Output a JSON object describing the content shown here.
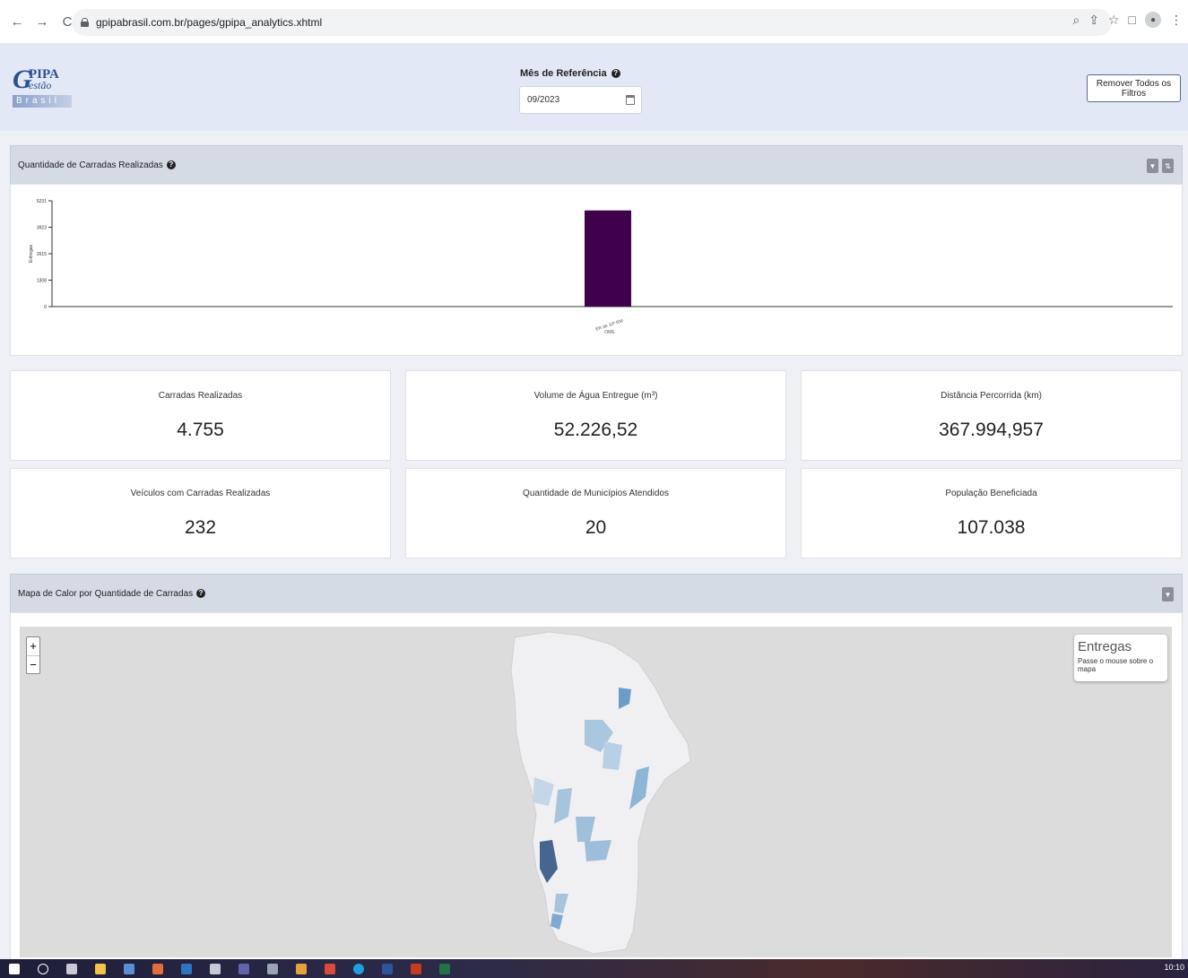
{
  "browser": {
    "url": "gpipabrasil.com.br/pages/gpipa_analytics.xhtml",
    "back_icon": "←",
    "forward_icon": "→",
    "reload_icon": "C"
  },
  "header": {
    "logo": {
      "line1": "PIPA",
      "line2": "estão",
      "line3": "Brasil",
      "g": "G"
    },
    "ref_label": "Mês de Referência",
    "ref_value": "09/2023",
    "remove_filters": "Remover Todos os Filtros"
  },
  "chart_panel": {
    "title": "Quantidade de Carradas Realizadas"
  },
  "chart_data": {
    "type": "bar",
    "categories": [
      "ER de 10ª RM"
    ],
    "values": [
      4755
    ],
    "xlabel": "OME",
    "ylabel": "Entregas",
    "yticks": [
      "0",
      "1308",
      "2615",
      "3923",
      "5231"
    ],
    "ylim": [
      0,
      5231
    ],
    "bar_color": "#40004b",
    "grid": false
  },
  "kpis": [
    {
      "label": "Carradas Realizadas",
      "value": "4.755"
    },
    {
      "label": "Volume de Água Entregue (m³)",
      "value": "52.226,52"
    },
    {
      "label": "Distância Percorrida (km)",
      "value": "367.994,957"
    },
    {
      "label": "Veículos com Carradas Realizadas",
      "value": "232"
    },
    {
      "label": "Quantidade de Municípios Atendidos",
      "value": "20"
    },
    {
      "label": "População Beneficiada",
      "value": "107.038"
    }
  ],
  "map_panel": {
    "title": "Mapa de Calor por Quantidade de Carradas",
    "zoom_in": "+",
    "zoom_out": "−",
    "legend_title": "Entregas",
    "legend_sub": "Passe o mouse sobre o mapa"
  },
  "taskbar": {
    "time": "10:10"
  },
  "colors": {
    "header_bg": "#e3e8f7",
    "panel_head": "#d5dbe5",
    "bar": "#40004b"
  }
}
